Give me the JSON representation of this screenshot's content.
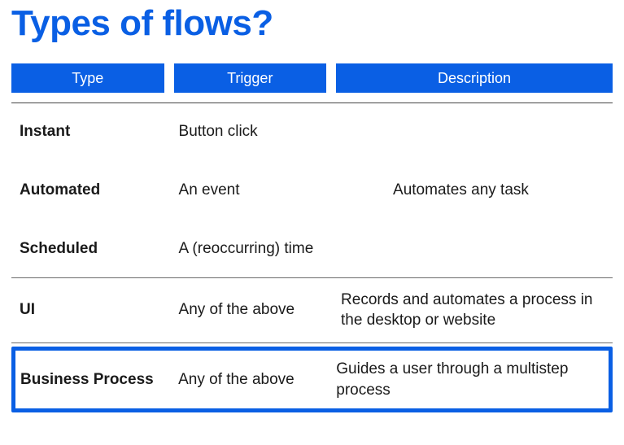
{
  "title": "Types of flows?",
  "columns": {
    "type": "Type",
    "trigger": "Trigger",
    "description": "Description"
  },
  "rows": [
    {
      "type": "Instant",
      "trigger": "Button click",
      "description": ""
    },
    {
      "type": "Automated",
      "trigger": "An event",
      "description": "Automates any task"
    },
    {
      "type": "Scheduled",
      "trigger": "A (reoccurring) time",
      "description": ""
    },
    {
      "type": "UI",
      "trigger": "Any of the above",
      "description": "Records and automates a process in the desktop or website"
    },
    {
      "type": "Business Process",
      "trigger": "Any of the above",
      "description": "Guides a user through a multistep process"
    }
  ],
  "accent_color": "#0a5fe4"
}
